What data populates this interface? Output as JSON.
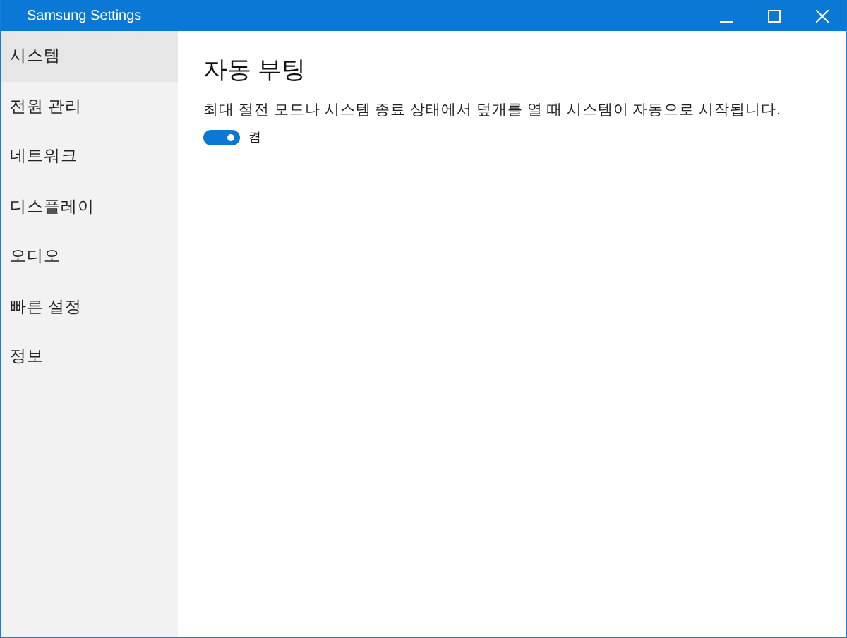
{
  "window": {
    "title": "Samsung Settings"
  },
  "sidebar": {
    "items": [
      {
        "label": "시스템",
        "selected": true
      },
      {
        "label": "전원 관리",
        "selected": false
      },
      {
        "label": "네트워크",
        "selected": false
      },
      {
        "label": "디스플레이",
        "selected": false
      },
      {
        "label": "오디오",
        "selected": false
      },
      {
        "label": "빠른 설정",
        "selected": false
      },
      {
        "label": "정보",
        "selected": false
      }
    ]
  },
  "content": {
    "title": "자동 부팅",
    "description": "최대 절전 모드나 시스템 종료 상태에서 덮개를 열 때 시스템이 자동으로 시작됩니다.",
    "toggle": {
      "on": true,
      "label": "켬"
    }
  }
}
